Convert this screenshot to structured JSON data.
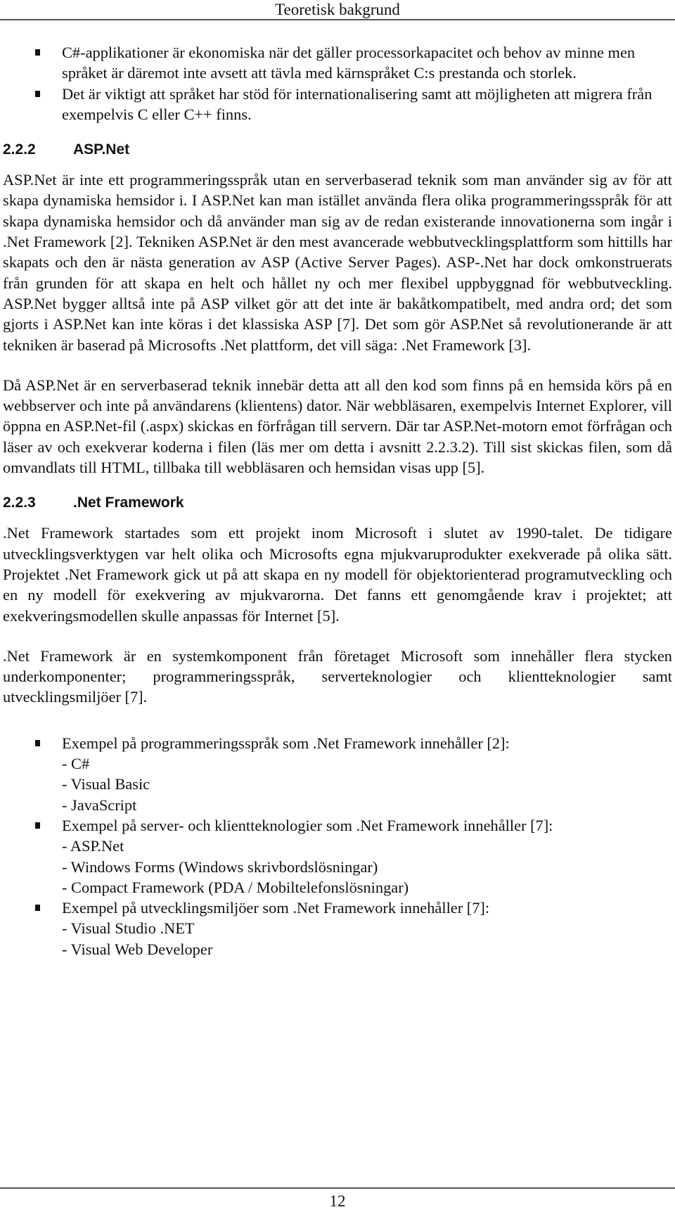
{
  "header": {
    "title": "Teoretisk bakgrund"
  },
  "intro_bullets": [
    "C#-applikationer är ekonomiska när det gäller processorkapacitet och behov av minne men språket är däremot inte avsett att tävla med kärnspråket C:s prestanda och storlek.",
    "Det är viktigt att språket har stöd för internationalisering samt att möjligheten att migrera från exempelvis C eller C++ finns."
  ],
  "section_222": {
    "number": "2.2.2",
    "title": "ASP.Net",
    "paragraphs": [
      "ASP.Net är inte ett programmeringsspråk utan en serverbaserad teknik som man använder sig av för att skapa dynamiska hemsidor i. I ASP.Net kan man istället använda flera olika programmeringsspråk för att skapa dynamiska hemsidor och då använder man sig av de redan existerande innovationerna som ingår i .Net Framework [2]. Tekniken ASP.Net är den mest avancerade webbutvecklingsplattform som hittills har skapats och den är nästa generation av ASP (Active Server Pages). ASP-.Net har dock omkonstruerats från grunden för att skapa en helt och hållet ny och mer flexibel uppbyggnad för webbutveckling. ASP.Net bygger alltså inte på ASP vilket gör att det inte är bakåtkompatibelt, med andra ord; det som gjorts i ASP.Net kan inte köras i det klassiska ASP [7]. Det som gör ASP.Net så revolutionerande är att tekniken är baserad på Microsofts .Net plattform, det vill säga: .Net Framework [3].",
      "Då ASP.Net är en serverbaserad teknik innebär detta att all den kod som finns på en hemsida körs på en webbserver och inte på användarens (klientens) dator. När webbläsaren, exempelvis Internet Explorer, vill öppna en ASP.Net-fil (.aspx) skickas en förfrågan till servern. Där tar ASP.Net-motorn emot förfrågan och läser av och exekverar koderna i filen (läs mer om detta i avsnitt 2.2.3.2). Till sist skickas filen, som då omvandlats till HTML, tillbaka till webbläsaren och hemsidan visas upp [5]."
    ]
  },
  "section_223": {
    "number": "2.2.3",
    "title": ".Net Framework",
    "paragraphs": [
      ".Net Framework startades som ett projekt inom Microsoft i slutet av 1990-talet. De tidigare utvecklingsverktygen var helt olika och Microsofts egna mjukvaruprodukter exekverade på olika sätt. Projektet .Net Framework gick ut på att skapa en ny modell för objektorienterad programutveckling och en ny modell för exekvering av mjukvarorna. Det fanns ett genomgående krav i projektet; att exekveringsmodellen skulle anpassas för Internet [5].",
      ".Net Framework är en systemkomponent från företaget Microsoft som innehåller flera stycken underkomponenter; programmeringsspråk, serverteknologier och klientteknologier samt utvecklingsmiljöer [7]."
    ],
    "bullets": [
      {
        "label": "Exempel på programmeringsspråk som .Net Framework innehåller [2]:",
        "items": [
          "- C#",
          "- Visual Basic",
          "- JavaScript"
        ]
      },
      {
        "label": "Exempel på server- och klientteknologier som .Net Framework innehåller [7]:",
        "items": [
          "- ASP.Net",
          "- Windows Forms (Windows skrivbordslösningar)",
          "- Compact Framework (PDA / Mobiltelefonslösningar)"
        ]
      },
      {
        "label": "Exempel på utvecklingsmiljöer som .Net Framework innehåller [7]:",
        "items": [
          "- Visual Studio .NET",
          "- Visual Web Developer"
        ]
      }
    ]
  },
  "footer": {
    "page_number": "12"
  }
}
